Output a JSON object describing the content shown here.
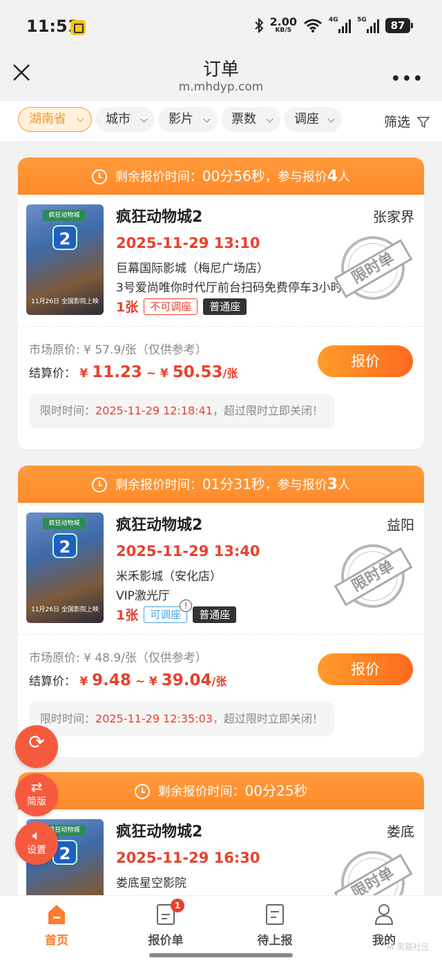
{
  "status_bar": {
    "time": "11:51",
    "net_speed": "2.00",
    "net_unit": "KB/S",
    "sig1_label": "4G",
    "sig2_label": "5G",
    "battery": "87"
  },
  "nav": {
    "title": "订单",
    "subtitle": "m.mhdyp.com"
  },
  "filters": {
    "chips": [
      {
        "label": "湖南省",
        "active": true
      },
      {
        "label": "城市"
      },
      {
        "label": "影片"
      },
      {
        "label": "票数"
      },
      {
        "label": "调座"
      }
    ],
    "filter_label": "筛选"
  },
  "orders": [
    {
      "countdown_label": "剩余报价时间：",
      "countdown": "00分56秒",
      "participants_label": "，参与报价",
      "participants": "4",
      "participants_unit": "人",
      "movie": "疯狂动物城2",
      "city": "张家界",
      "showtime": "2025-11-29 13:10",
      "cinema": "巨幕国际影城（梅尼广场店）",
      "hall": "3号爱尚唯你时代厅前台扫码免费停车3小时",
      "qty": "1张",
      "seat_adjust": "不可调座",
      "seat_type": "普通座",
      "stamp": "限时单",
      "market_price": "市场原价: ¥ 57.9/张（仅供参考）",
      "settle_label": "结算价：",
      "price_min": "11.23",
      "price_max": "50.53",
      "price_unit": "/张",
      "quote_button": "报价",
      "limit_label": "限时时间：",
      "limit_time": "2025-11-29 12:18:41",
      "limit_suffix": "，超过限时立即关闭！"
    },
    {
      "countdown_label": "剩余报价时间：",
      "countdown": "01分31秒",
      "participants_label": "，参与报价",
      "participants": "3",
      "participants_unit": "人",
      "movie": "疯狂动物城2",
      "city": "益阳",
      "showtime": "2025-11-29 13:40",
      "cinema": "米禾影城（安化店）",
      "hall": "VIP激光厅",
      "qty": "1张",
      "seat_adjust": "可调座",
      "seat_type": "普通座",
      "stamp": "限时单",
      "market_price": "市场原价: ¥ 48.9/张（仅供参考）",
      "settle_label": "结算价：",
      "price_min": "9.48",
      "price_max": "39.04",
      "price_unit": "/张",
      "quote_button": "报价",
      "limit_label": "限时时间：",
      "limit_time": "2025-11-29 12:35:03",
      "limit_suffix": "，超过限时立即关闭！"
    },
    {
      "countdown_label": "剩余报价时间：",
      "countdown": "00分25秒",
      "movie": "疯狂动物城2",
      "city": "娄底",
      "showtime": "2025-11-29 16:30",
      "cinema": "娄底星空影院",
      "stamp": "限时单"
    }
  ],
  "fabs": {
    "simple_label": "简版",
    "settings_label": "设置"
  },
  "tabbar": {
    "tabs": [
      {
        "label": "首页",
        "active": true
      },
      {
        "label": "报价单",
        "badge": "1"
      },
      {
        "label": "待上报"
      },
      {
        "label": "我的"
      }
    ]
  },
  "watermark": "M 黑猫社区",
  "colors": {
    "accent": "#ff8a2a",
    "price_red": "#e8412b",
    "adjustable_blue": "#4aa3df"
  },
  "poster": {
    "sign": "疯狂动物城",
    "num": "2",
    "date": "11月26日 全国影院上映"
  }
}
